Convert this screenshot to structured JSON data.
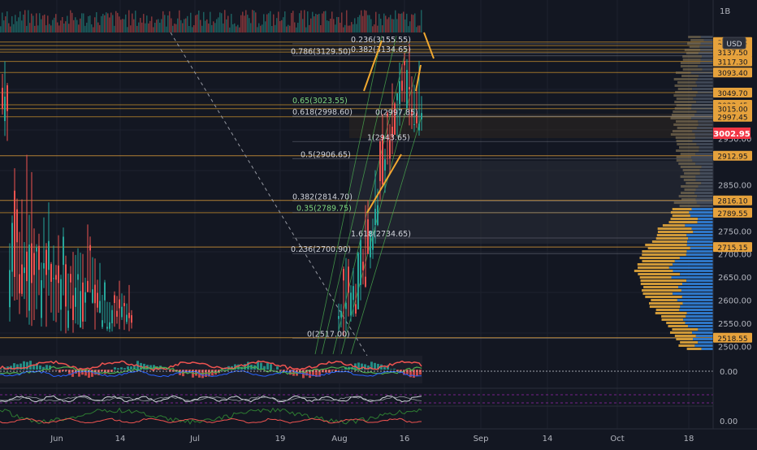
{
  "chart_data": {
    "type": "candlestick",
    "currency_label": "USD",
    "current_price": "3002.95",
    "x_ticks": [
      "Jun",
      "14",
      "Jul",
      "19",
      "Aug",
      "16",
      "Sep",
      "14",
      "Oct",
      "18"
    ],
    "volume_axis_label": "1B",
    "y_ticks": [
      "2950.00",
      "2850.00",
      "2750.00",
      "2700.00",
      "2650.00",
      "2600.00",
      "2550.00",
      "2500.00"
    ],
    "price_levels": [
      "3159.25",
      "3151.65",
      "3142.95",
      "3137.50",
      "3117.30",
      "3093.40",
      "3049.70",
      "3023.45",
      "3015.00",
      "2997.45",
      "2912.95",
      "2816.10",
      "2789.55",
      "2715.15",
      "2518.55"
    ],
    "ylim": [
      2490,
      3180
    ],
    "fib_labels": [
      {
        "text": "0.786(3129.50)",
        "value": 3129.5,
        "color": "white"
      },
      {
        "text": "0.65(3023.55)",
        "value": 3023.55,
        "color": "green"
      },
      {
        "text": "0.618(2998.60)",
        "value": 2998.6,
        "color": "white"
      },
      {
        "text": "0.5(2906.65)",
        "value": 2906.65,
        "color": "white"
      },
      {
        "text": "0.382(2814.70)",
        "value": 2814.7,
        "color": "white"
      },
      {
        "text": "0.35(2789.75)",
        "value": 2789.75,
        "color": "green"
      },
      {
        "text": "1.618(2734.65)",
        "value": 2734.65,
        "color": "white"
      },
      {
        "text": "0.236(2700.90)",
        "value": 2700.9,
        "color": "white"
      },
      {
        "text": "0(2517.00)",
        "value": 2517.0,
        "color": "white"
      },
      {
        "text": "0.236(3155.55)",
        "value": 3155.55,
        "color": "white"
      },
      {
        "text": "0.382(3134.65)",
        "value": 3134.65,
        "color": "white"
      },
      {
        "text": "0(2997.85)",
        "value": 2997.85,
        "color": "white"
      },
      {
        "text": "1(2943.65)",
        "value": 2943.65,
        "color": "white"
      }
    ],
    "oscillator_ticks": [
      "0.00",
      "0.00"
    ],
    "candles_approx": [
      {
        "t": 0.02,
        "h": 3000,
        "l": 2520
      },
      {
        "t": 0.04,
        "h": 2990,
        "l": 2560
      },
      {
        "t": 0.09,
        "h": 2870,
        "l": 2530
      },
      {
        "t": 0.13,
        "h": 2840,
        "l": 2530
      },
      {
        "t": 0.16,
        "h": 2770,
        "l": 2520
      },
      {
        "t": 0.2,
        "h": 2780,
        "l": 2540
      },
      {
        "t": 0.26,
        "h": 2670,
        "l": 2520
      },
      {
        "t": 0.3,
        "h": 2650,
        "l": 2530
      },
      {
        "t": 0.83,
        "h": 2700,
        "l": 2517
      },
      {
        "t": 0.87,
        "h": 2850,
        "l": 2640
      },
      {
        "t": 0.91,
        "h": 3050,
        "l": 2820
      },
      {
        "t": 0.95,
        "h": 3155,
        "l": 2990
      },
      {
        "t": 0.99,
        "h": 3159,
        "l": 2944
      }
    ]
  }
}
